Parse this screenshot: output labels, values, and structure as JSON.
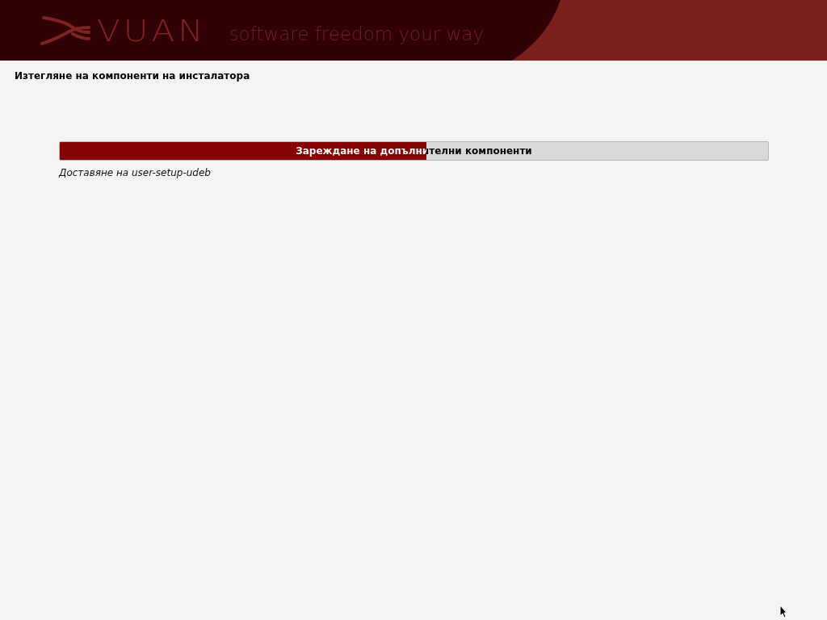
{
  "header": {
    "logo": "VUAN",
    "tagline": "software freedom your way"
  },
  "title": "Изтегляне на компоненти на инсталатора",
  "progress": {
    "label": "Зареждане на допълнителни компоненти",
    "level": 0.518
  },
  "status": "Доставяне на user-setup-udeb"
}
